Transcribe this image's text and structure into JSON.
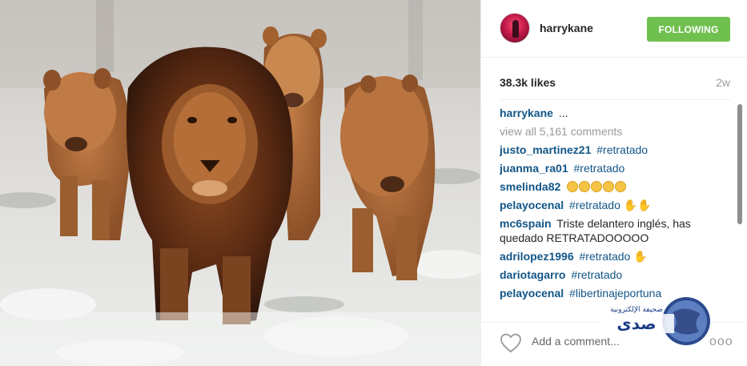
{
  "post": {
    "username": "harrykane",
    "follow_label": "FOLLOWING",
    "likes": "38.3k likes",
    "time": "2w",
    "caption_user": "harrykane",
    "caption_text": "...",
    "view_all": "view all 5,161 comments",
    "comments": [
      {
        "user": "justo_martinez21",
        "text": "#retratado",
        "is_tag": true
      },
      {
        "user": "juanma_ra01",
        "text": "#retratado",
        "is_tag": true
      },
      {
        "user": "smelinda82",
        "text": "",
        "is_tag": false,
        "emoji": "grin-faces"
      },
      {
        "user": "pelayocenal",
        "text": "#retratado",
        "is_tag": true,
        "emoji": "hands"
      },
      {
        "user": "mc6spain",
        "text": "Triste delantero inglés, has quedado RETRATADOOOOO",
        "is_tag": false
      },
      {
        "user": "adrilopez1996",
        "text": "#retratado",
        "is_tag": true,
        "emoji": "hand"
      },
      {
        "user": "dariotagarro",
        "text": "#retratado",
        "is_tag": true
      },
      {
        "user": "pelayocenal",
        "text": "#libertinajeportuna",
        "is_tag": true
      }
    ],
    "add_comment_placeholder": "Add a comment...",
    "more_label": "ooo"
  },
  "watermark": {
    "text_ar": "صدى",
    "sub_ar": "صحيفة الإلكترونية"
  },
  "colors": {
    "follow_green": "#70c050",
    "link_blue": "#125688",
    "muted": "#999999"
  },
  "icons": {
    "heart": "heart-icon",
    "more": "more-options-icon"
  }
}
